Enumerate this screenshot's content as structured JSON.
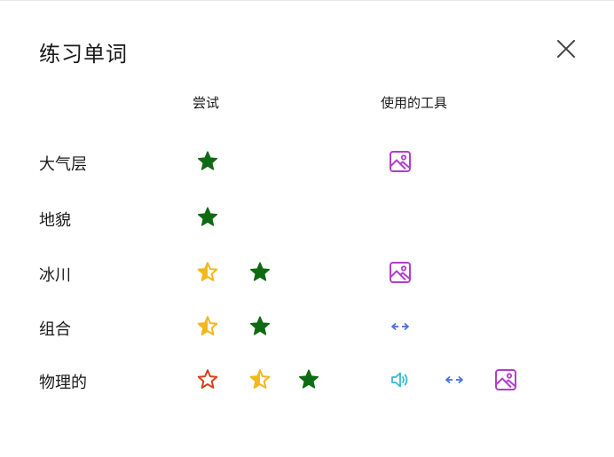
{
  "dialog": {
    "title": "练习单词",
    "close_icon": "close-icon"
  },
  "columns": {
    "attempts": "尝试",
    "tools": "使用的工具"
  },
  "colors": {
    "star_correct": "#0f6b13",
    "star_partial": "#f2b81c",
    "star_wrong": "#d9401c",
    "picture_tool": "#b13fc9",
    "translate_tool": "#4a6fe0",
    "audio_tool": "#36b9d0"
  },
  "words": [
    {
      "word": "大气层",
      "attempts": [
        "correct"
      ],
      "tools": [
        "picture-icon"
      ]
    },
    {
      "word": "地貌",
      "attempts": [
        "correct"
      ],
      "tools": []
    },
    {
      "word": "冰川",
      "attempts": [
        "partial",
        "correct"
      ],
      "tools": [
        "picture-icon"
      ]
    },
    {
      "word": "组合",
      "attempts": [
        "partial",
        "correct"
      ],
      "tools": [
        "translate-arrows-icon"
      ]
    },
    {
      "word": "物理的",
      "attempts": [
        "wrong",
        "partial",
        "correct"
      ],
      "tools": [
        "audio-icon",
        "translate-arrows-icon",
        "picture-icon"
      ]
    }
  ]
}
